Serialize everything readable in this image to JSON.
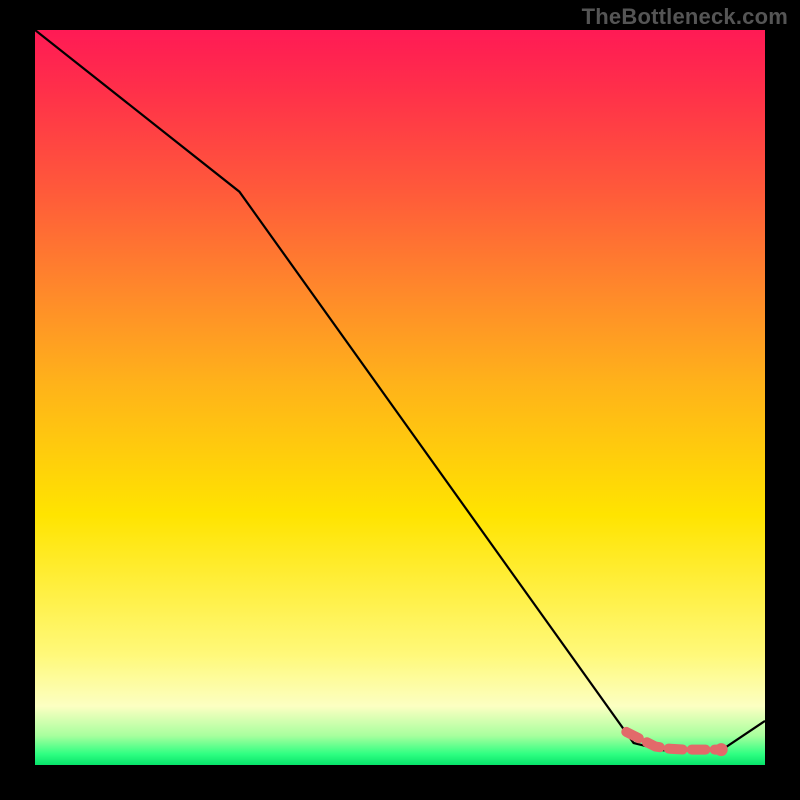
{
  "watermark": "TheBottleneck.com",
  "chart_data": {
    "type": "line",
    "title": "",
    "xlabel": "",
    "ylabel": "",
    "xlim": [
      0,
      100
    ],
    "ylim": [
      0,
      100
    ],
    "grid": false,
    "legend": false,
    "series": [
      {
        "name": "curve",
        "color": "#000000",
        "x": [
          0,
          28,
          82,
          86,
          90,
          94,
          100
        ],
        "values": [
          100,
          78,
          3,
          2,
          2,
          2,
          6
        ]
      }
    ],
    "marker_region": {
      "name": "highlighted-segment",
      "color": "#e26a6a",
      "x": [
        81,
        83,
        85,
        87,
        89,
        91,
        93,
        94
      ],
      "values": [
        4.5,
        3.5,
        2.5,
        2.2,
        2.1,
        2.1,
        2.1,
        2.1
      ],
      "end_point": {
        "x": 94,
        "y": 2.1
      }
    }
  }
}
